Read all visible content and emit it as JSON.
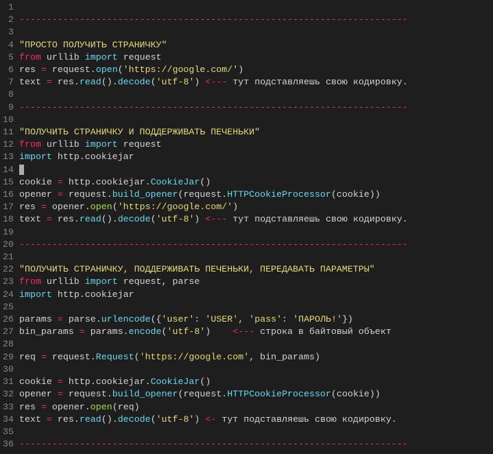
{
  "cursor_line": 14,
  "dash_string": "-----------------------------------------------------------------------",
  "lines": {
    "l4": {
      "title": "\"ПРОСТО ПОЛУЧИТЬ СТРАНИЧКУ\""
    },
    "l5": {
      "from": "from",
      "m1": "urllib",
      "import": "import",
      "m2": "request"
    },
    "l6": {
      "lhs": "res",
      "eq": "=",
      "obj": "request",
      "meth": "open",
      "arg": "'https://google.com/'"
    },
    "l7": {
      "lhs": "text",
      "eq": "=",
      "obj": "res",
      "m1": "read",
      "m2": "decode",
      "arg": "'utf-8'",
      "arrow": "<---",
      "tail": "тут подставляешь свою кодировку."
    },
    "l11_title": "\"ПОЛУЧИТЬ СТРАНИЧКУ И ПОДДЕРЖИВАТЬ ПЕЧЕНЬКИ\"",
    "l12": {
      "from": "from",
      "m1": "urllib",
      "import": "import",
      "m2": "request"
    },
    "l13": {
      "import": "import",
      "m1": "http",
      "m2": "cookiejar"
    },
    "l15": {
      "lhs": "cookie",
      "eq": "=",
      "p1": "http",
      "p2": "cookiejar",
      "cls": "CookieJar"
    },
    "l16": {
      "lhs": "opener",
      "eq": "=",
      "p1": "request",
      "m1": "build_opener",
      "p2": "request",
      "m2": "HTTPCookieProcessor",
      "arg": "cookie"
    },
    "l17": {
      "lhs": "res",
      "eq": "=",
      "p1": "opener",
      "m1": "open",
      "arg": "'https://google.com/'"
    },
    "l18": {
      "lhs": "text",
      "eq": "=",
      "obj": "res",
      "m1": "read",
      "m2": "decode",
      "arg": "'utf-8'",
      "arrow": "<---",
      "tail": "тут подставляешь свою кодировку."
    },
    "l22_title": "\"ПОЛУЧИТЬ СТРАНИЧКУ, ПОДДЕРЖИВАТЬ ПЕЧЕНЬКИ, ПЕРЕДАВАТЬ ПАРАМЕТРЫ\"",
    "l23": {
      "from": "from",
      "m1": "urllib",
      "import": "import",
      "m2": "request",
      "comma": ",",
      "m3": "parse"
    },
    "l24": {
      "import": "import",
      "m1": "http",
      "m2": "cookiejar"
    },
    "l26": {
      "lhs": "params",
      "eq": "=",
      "p1": "parse",
      "m1": "urlencode",
      "k1": "'user'",
      "v1": "'USER'",
      "k2": "'pass'",
      "v2": "'ПАРОЛЬ!'"
    },
    "l27": {
      "lhs": "bin_params",
      "eq": "=",
      "p1": "params",
      "m1": "encode",
      "arg": "'utf-8'",
      "arrow": "<---",
      "tail": "строка в байтовый объект"
    },
    "l29": {
      "lhs": "req",
      "eq": "=",
      "p1": "request",
      "m1": "Request",
      "a1": "'https://google.com'",
      "a2": "bin_params"
    },
    "l31": {
      "lhs": "cookie",
      "eq": "=",
      "p1": "http",
      "p2": "cookiejar",
      "cls": "CookieJar"
    },
    "l32": {
      "lhs": "opener",
      "eq": "=",
      "p1": "request",
      "m1": "build_opener",
      "p2": "request",
      "m2": "HTTPCookieProcessor",
      "arg": "cookie"
    },
    "l33": {
      "lhs": "res",
      "eq": "=",
      "p1": "opener",
      "m1": "open",
      "arg": "req"
    },
    "l34": {
      "lhs": "text",
      "eq": "=",
      "obj": "res",
      "m1": "read",
      "m2": "decode",
      "arg": "'utf-8'",
      "arrow": "<-",
      "tail": "тут подставляешь свою кодировку."
    }
  },
  "line_numbers": [
    "1",
    "2",
    "3",
    "4",
    "5",
    "6",
    "7",
    "8",
    "9",
    "10",
    "11",
    "12",
    "13",
    "14",
    "15",
    "16",
    "17",
    "18",
    "19",
    "20",
    "21",
    "22",
    "23",
    "24",
    "25",
    "26",
    "27",
    "28",
    "29",
    "30",
    "31",
    "32",
    "33",
    "34",
    "35",
    "36"
  ]
}
